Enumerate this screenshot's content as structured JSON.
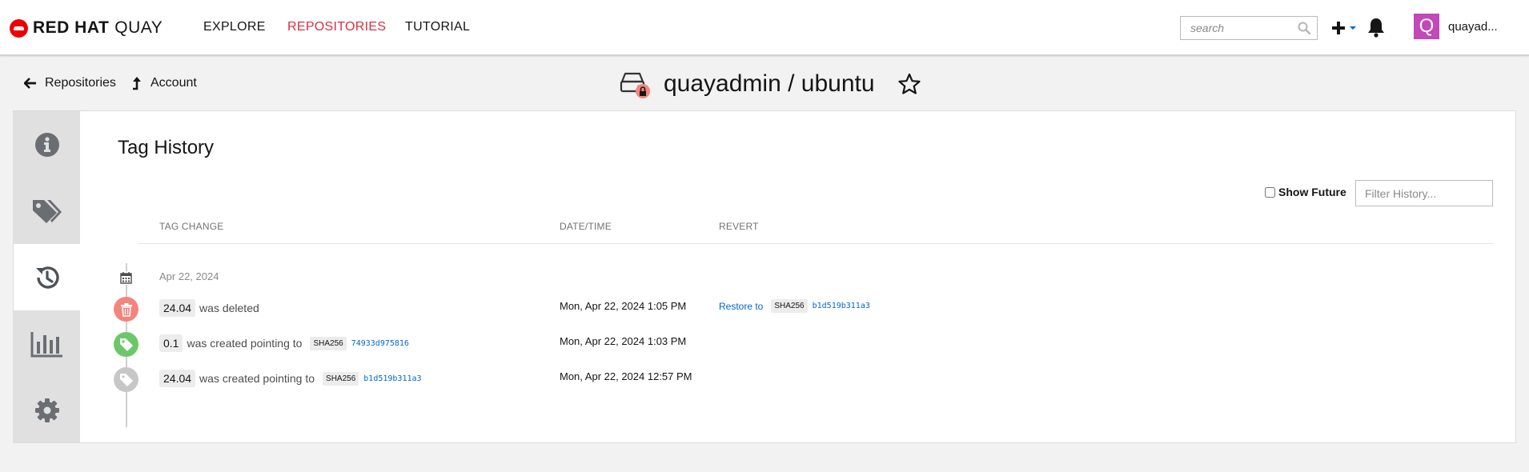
{
  "app": {
    "brand": "RED HAT",
    "product": "QUAY"
  },
  "nav": {
    "explore": "EXPLORE",
    "repositories": "REPOSITORIES",
    "tutorial": "TUTORIAL",
    "active_color": "#d6303f"
  },
  "search": {
    "placeholder": "search"
  },
  "user": {
    "avatar_letter": "Q",
    "name": "quayad...",
    "avatar_color": "#c348b8"
  },
  "breadcrumb": {
    "repositories": "Repositories",
    "account": "Account"
  },
  "repo": {
    "title": "quayadmin / ubuntu",
    "private": true
  },
  "sidebar": {
    "items": [
      {
        "icon": "info-icon",
        "active": false
      },
      {
        "icon": "tags-icon",
        "active": false
      },
      {
        "icon": "history-icon",
        "active": true
      },
      {
        "icon": "chart-icon",
        "active": false
      },
      {
        "icon": "gear-icon",
        "active": false
      }
    ]
  },
  "history": {
    "title": "Tag History",
    "show_future_label": "Show Future",
    "show_future_checked": false,
    "filter_placeholder": "Filter History...",
    "columns": {
      "tag_change": "TAG CHANGE",
      "datetime": "DATE/TIME",
      "revert": "REVERT"
    },
    "date_group": "Apr 22, 2024",
    "entries": [
      {
        "kind": "deleted",
        "icon": "trash-icon",
        "icon_color": "#f4857d",
        "tag": "24.04",
        "verb": "was deleted",
        "datetime": "Mon, Apr 22, 2024 1:05 PM",
        "revert": {
          "label": "Restore to",
          "sha_label": "SHA256",
          "sha": "b1d519b311a3"
        }
      },
      {
        "kind": "created",
        "icon": "tag-icon",
        "icon_color": "#6cc76a",
        "tag": "0.1",
        "verb": "was created pointing to",
        "sha_label": "SHA256",
        "sha": "74933d975816",
        "datetime": "Mon, Apr 22, 2024 1:03 PM"
      },
      {
        "kind": "created-old",
        "icon": "tag-icon",
        "icon_color": "#c7c7c7",
        "tag": "24.04",
        "verb": "was created pointing to",
        "sha_label": "SHA256",
        "sha": "b1d519b311a3",
        "datetime": "Mon, Apr 22, 2024 12:57 PM"
      }
    ]
  }
}
